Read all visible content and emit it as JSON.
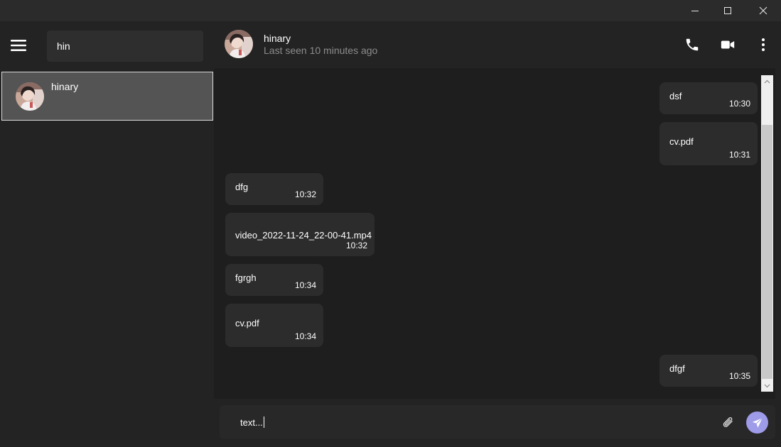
{
  "colors": {
    "accent": "#9e9be8",
    "sidebar_bg": "#232323",
    "messages_bg": "#1e1e1e",
    "bubble_bg": "#2c2c2c",
    "selected_bg": "#545454"
  },
  "titlebar": {
    "icons": [
      "minimize-icon",
      "maximize-icon",
      "close-icon"
    ]
  },
  "sidebar": {
    "menu_icon": "hamburger-menu-icon",
    "search_value": "hin",
    "contacts": [
      {
        "name": "hinary",
        "selected": true
      }
    ]
  },
  "chat": {
    "contact_name": "hinary",
    "status": "Last seen 10 minutes ago",
    "header_icons": [
      "phone-icon",
      "video-camera-icon",
      "more-vertical-icon"
    ]
  },
  "messages": [
    {
      "text": "dsf",
      "time": "10:30",
      "direction": "outgoing"
    },
    {
      "text": "cv.pdf",
      "time": "10:31",
      "direction": "outgoing"
    },
    {
      "text": "dfg",
      "time": "10:32",
      "direction": "incoming"
    },
    {
      "text": "video_2022-11-24_22-00-41.mp4",
      "time": "10:32",
      "direction": "incoming"
    },
    {
      "text": "fgrgh",
      "time": "10:34",
      "direction": "incoming"
    },
    {
      "text": "cv.pdf",
      "time": "10:34",
      "direction": "incoming"
    },
    {
      "text": "dfgf",
      "time": "10:35",
      "direction": "outgoing"
    }
  ],
  "composer": {
    "value": "text...",
    "icons": [
      "paperclip-icon",
      "send-icon"
    ]
  }
}
